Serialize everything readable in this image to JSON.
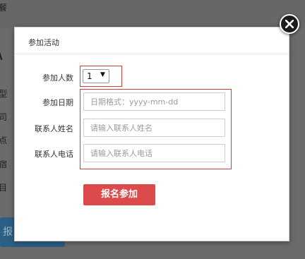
{
  "background": {
    "top_glyph": "餐",
    "big_glyph": "\\",
    "side_glyphs": [
      "型",
      "司",
      "点",
      "宿",
      "目"
    ],
    "button_label": "报"
  },
  "modal": {
    "title": "参加活动",
    "close_icon": "close-icon",
    "fields": {
      "participants_label": "参加人数",
      "participants_value": "1",
      "date_label": "参加日期",
      "date_placeholder": "日期格式：yyyy-mm-dd",
      "contact_name_label": "联系人姓名",
      "contact_name_placeholder": "请输入联系人姓名",
      "contact_phone_label": "联系人电话",
      "contact_phone_placeholder": "请输入联系人电话"
    },
    "submit_label": "报名参加"
  },
  "colors": {
    "accent": "#dc4a4b",
    "highlight_border": "#d33c3c"
  }
}
